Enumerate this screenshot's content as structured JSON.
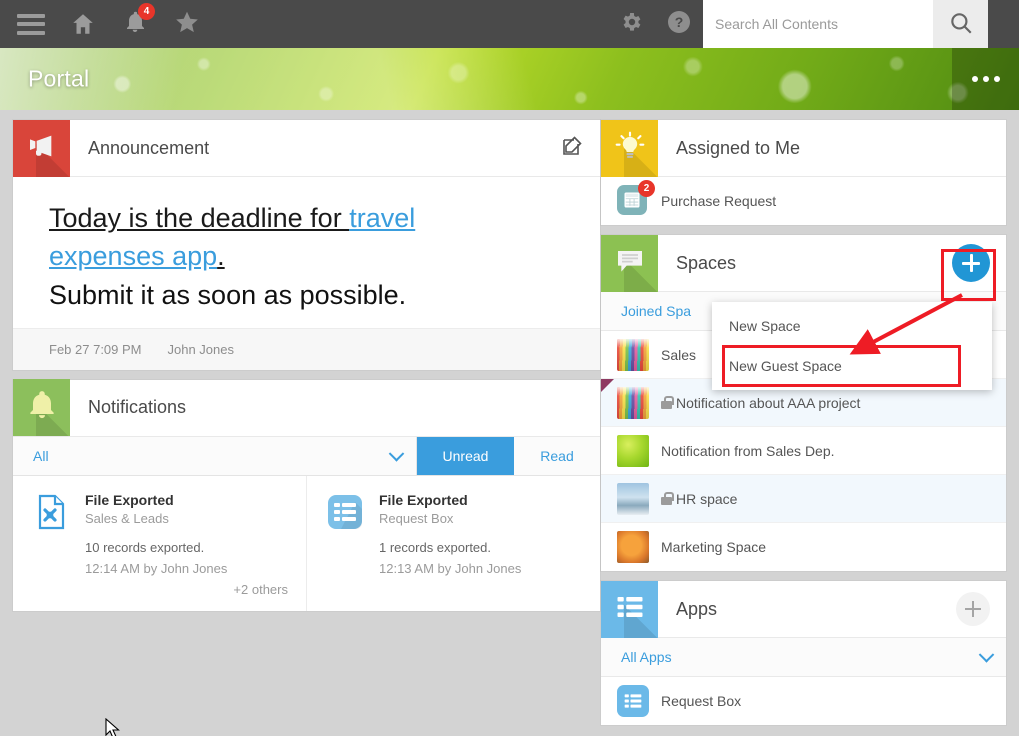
{
  "topbar": {
    "menu_icon": "hamburger-icon",
    "home_icon": "home-icon",
    "bell_icon": "bell-icon",
    "bell_badge": "4",
    "star_icon": "star-icon",
    "gear_icon": "gear-icon",
    "help_icon": "help-icon",
    "search_placeholder": "Search All Contents",
    "search_value": "",
    "search_icon": "search-icon"
  },
  "banner": {
    "title": "Portal",
    "more_icon": "more-dots-icon"
  },
  "announcement": {
    "icon": "megaphone-icon",
    "title": "Announcement",
    "edit_icon": "edit-pencil-icon",
    "line1_plain": "Today is the deadline for ",
    "line1_link": "travel",
    "line2_link": "expenses app",
    "line2_period": ".",
    "line3": "Submit it as soon as possible.",
    "date": "Feb 27 7:09 PM",
    "author": "John Jones"
  },
  "notifications": {
    "icon": "bell-icon",
    "title": "Notifications",
    "filter_label": "All",
    "filter_chevron": "chevron-down-icon",
    "tab_unread": "Unread",
    "tab_read": "Read",
    "active_tab": "Unread",
    "items": [
      {
        "icon": "file-export-icon",
        "title": "File Exported",
        "source": "Sales & Leads",
        "description": "10 records exported.",
        "meta": "12:14 AM  by John Jones",
        "others": "+2 others"
      },
      {
        "icon": "request-box-icon",
        "title": "File Exported",
        "source": "Request Box",
        "description": "1 records exported.",
        "meta": "12:13 AM  by John Jones",
        "others": ""
      }
    ]
  },
  "assigned": {
    "icon": "lightbulb-icon",
    "title": "Assigned to Me",
    "items": [
      {
        "icon": "purchase-request-icon",
        "label": "Purchase Request",
        "badge": "2"
      }
    ]
  },
  "spaces": {
    "icon": "speech-bubble-icon",
    "title": "Spaces",
    "add_icon": "plus-icon",
    "tab_label": "Joined Spa",
    "items": [
      {
        "thumb": "pencils-thumb",
        "label": "Sales",
        "locked": false,
        "flag": false
      },
      {
        "thumb": "pencils-thumb",
        "label": "Notification about AAA project",
        "locked": true,
        "flag": true
      },
      {
        "thumb": "leaf-thumb",
        "label": "Notification from Sales Dep.",
        "locked": false,
        "flag": false
      },
      {
        "thumb": "winter-thumb",
        "label": "HR space",
        "locked": true,
        "flag": false
      },
      {
        "thumb": "orange-thumb",
        "label": "Marketing Space",
        "locked": false,
        "flag": false
      }
    ]
  },
  "dropdown": {
    "items": [
      {
        "label": "New Space",
        "highlighted": false
      },
      {
        "label": "New Guest Space",
        "highlighted": true
      }
    ]
  },
  "apps": {
    "icon": "list-icon",
    "title": "Apps",
    "add_icon": "plus-icon",
    "filter_label": "All Apps",
    "filter_chevron": "chevron-down-icon",
    "items": [
      {
        "icon": "request-box-icon",
        "label": "Request Box"
      }
    ]
  },
  "colors": {
    "topbar_bg": "#4a4a4a",
    "accent_blue": "#3a9ddd",
    "plus_blue": "#2196d5",
    "annotation_red": "#ee1c25",
    "badge_red": "#e8352a",
    "announcement_tile": "#d9453a",
    "notifications_tile": "#8cbf5c",
    "assigned_tile": "#f0c419",
    "spaces_tile": "#8cc152",
    "apps_tile": "#6bb9e8",
    "page_bg": "#d3d3d3"
  }
}
